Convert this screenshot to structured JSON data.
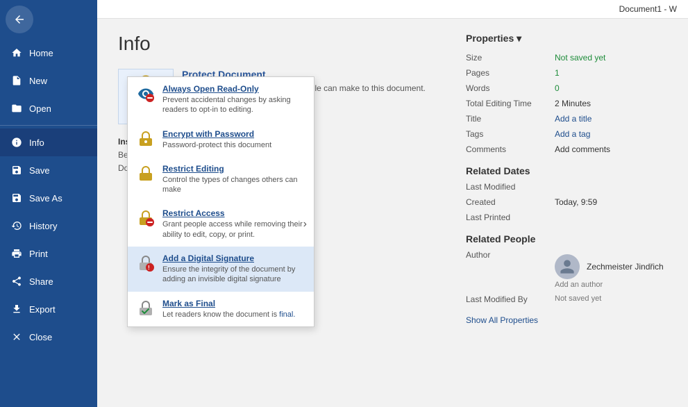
{
  "titlebar": {
    "text": "Document1 - W"
  },
  "sidebar": {
    "back_label": "Back",
    "items": [
      {
        "id": "home",
        "label": "Home",
        "icon": "home"
      },
      {
        "id": "new",
        "label": "New",
        "icon": "new"
      },
      {
        "id": "open",
        "label": "Open",
        "icon": "open"
      },
      {
        "id": "info",
        "label": "Info",
        "icon": "info",
        "active": true
      },
      {
        "id": "save",
        "label": "Save",
        "icon": "save"
      },
      {
        "id": "saveas",
        "label": "Save As",
        "icon": "saveas"
      },
      {
        "id": "history",
        "label": "History",
        "icon": "history"
      },
      {
        "id": "print",
        "label": "Print",
        "icon": "print"
      },
      {
        "id": "share",
        "label": "Share",
        "icon": "share"
      },
      {
        "id": "export",
        "label": "Export",
        "icon": "export"
      },
      {
        "id": "close",
        "label": "Close",
        "icon": "close"
      }
    ]
  },
  "page": {
    "title": "Info"
  },
  "protect": {
    "icon_label": "Protect Document ▾",
    "title": "Protect Document",
    "description": "Control what types of changes people can make to this document."
  },
  "doc_info": {
    "line1": "Inspect Document",
    "line2": "Before publishing this file, be aware that it contains:",
    "line3": "Document properties, author's name"
  },
  "dropdown": {
    "items": [
      {
        "id": "always-open",
        "title": "Always Open Read-Only",
        "description": "Prevent accidental changes by asking readers to opt-in to editing.",
        "highlighted": false,
        "has_arrow": false
      },
      {
        "id": "encrypt",
        "title": "Encrypt with Password",
        "description": "Password-protect this document",
        "highlighted": false,
        "has_arrow": false
      },
      {
        "id": "restrict-editing",
        "title": "Restrict Editing",
        "description": "Control the types of changes others can make",
        "highlighted": false,
        "has_arrow": false
      },
      {
        "id": "restrict-access",
        "title": "Restrict Access",
        "description": "Grant people access while removing their ability to edit, copy, or print.",
        "highlighted": false,
        "has_arrow": true
      },
      {
        "id": "digital-signature",
        "title": "Add a Digital Signature",
        "description": "Ensure the integrity of the document by adding an invisible digital signature",
        "highlighted": true,
        "has_arrow": false
      },
      {
        "id": "mark-final",
        "title": "Mark as Final",
        "description": "Let readers know the document is final.",
        "highlighted": false,
        "has_arrow": false
      }
    ]
  },
  "properties": {
    "title": "Properties ▾",
    "fields": [
      {
        "label": "Size",
        "value": "Not saved yet",
        "type": "green"
      },
      {
        "label": "Pages",
        "value": "1",
        "type": "green"
      },
      {
        "label": "Words",
        "value": "0",
        "type": "green"
      },
      {
        "label": "Total Editing Time",
        "value": "2 Minutes",
        "type": "normal"
      },
      {
        "label": "Title",
        "value": "Add a title",
        "type": "link"
      },
      {
        "label": "Tags",
        "value": "Add a tag",
        "type": "link"
      },
      {
        "label": "Comments",
        "value": "Add comments",
        "type": "normal"
      }
    ],
    "related_dates_title": "Related Dates",
    "dates": [
      {
        "label": "Last Modified",
        "value": ""
      },
      {
        "label": "Created",
        "value": "Today, 9:59"
      },
      {
        "label": "Last Printed",
        "value": ""
      }
    ],
    "related_people_title": "Related People",
    "author_label": "Author",
    "author_name": "Zechmeister Jindřich",
    "add_author": "Add an author",
    "last_modified_by_label": "Last Modified By",
    "last_modified_by_value": "Not saved yet",
    "show_all": "Show All Properties"
  }
}
